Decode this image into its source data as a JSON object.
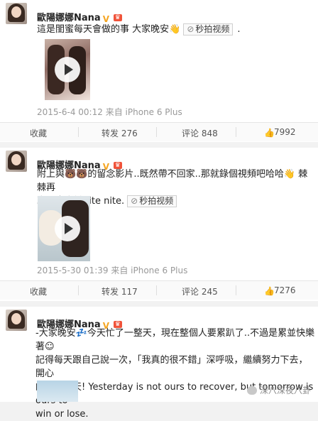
{
  "posts": [
    {
      "author": "歐陽娜娜Nana",
      "text": "這是閨蜜每天會做的事 大家晚安👋",
      "video_tag": "秒拍视频",
      "trailing": ".",
      "time": "2015-6-4 00:12",
      "source": "来自 iPhone 6 Plus",
      "actions": {
        "collect": "收藏",
        "repost": "转发 276",
        "comment": "评论 848",
        "like": "7992"
      }
    },
    {
      "author": "歐陽娜娜Nana",
      "text_line1": "附上與🐻🐻的留念影片..既然帶不回家..那就錄個視頻吧哈哈👋",
      "text_line1_tail": "棘棘再",
      "text_line2": "次跟大家說nite nite.",
      "video_tag": "秒拍视频",
      "time": "2015-5-30 01:39",
      "source": "来自 iPhone 6 Plus",
      "actions": {
        "collect": "收藏",
        "repost": "转发 117",
        "comment": "评论 245",
        "like": "7276"
      }
    },
    {
      "author": "歐陽娜娜Nana",
      "lines": [
        "-大家晚安💤今天忙了一整天，現在整個人要累趴了..不過是累並快樂著☺",
        "記得每天跟自己說一次，「我真的很不錯」深呼吸，繼續努力下去，開心",
        "的迎接明天! Yesterday is not ours to recover, but tomorrow is ours to",
        "win or lose."
      ]
    }
  ],
  "watermark": "深八深夜八卦",
  "icons": {
    "video": "video-pin-icon",
    "repost": "repost-icon",
    "comment": "comment-icon",
    "like": "thumbs-up-icon"
  }
}
